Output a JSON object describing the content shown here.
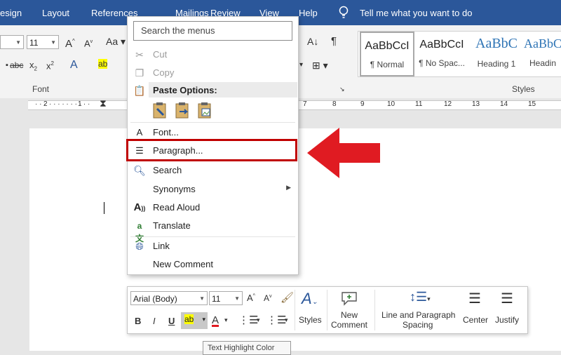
{
  "tabs": [
    "esign",
    "Layout",
    "References",
    "Mailings",
    "Review",
    "View",
    "Help"
  ],
  "tell_me": "Tell me what you want to do",
  "ribbon": {
    "font_size": "11",
    "font_group_label": "Font",
    "styles_group_label": "Styles",
    "styles": [
      {
        "preview": "AaBbCcI",
        "name": "¶ Normal"
      },
      {
        "preview": "AaBbCcI",
        "name": "¶ No Spac..."
      },
      {
        "preview": "AaBbC",
        "name": "Heading 1"
      },
      {
        "preview": "AaBbC",
        "name": "Headin"
      }
    ]
  },
  "ruler": {
    "left_numbers": [
      "1",
      "2",
      "1"
    ],
    "right_numbers": [
      "7",
      "8",
      "9",
      "10",
      "11",
      "12",
      "13",
      "14",
      "15"
    ]
  },
  "context_menu": {
    "search_placeholder": "Search the menus",
    "cut": "Cut",
    "copy": "Copy",
    "paste_options": "Paste Options:",
    "font": "Font...",
    "paragraph": "Paragraph...",
    "search": "Search",
    "synonyms": "Synonyms",
    "read_aloud": "Read Aloud",
    "translate": "Translate",
    "link": "Link",
    "new_comment": "New Comment"
  },
  "mini_toolbar": {
    "font_name": "Arial (Body)",
    "font_size": "11",
    "bold": "B",
    "italic": "I",
    "underline": "U",
    "styles": "Styles",
    "new_comment_1": "New",
    "new_comment_2": "Comment",
    "line_spacing_1": "Line and Paragraph",
    "line_spacing_2": "Spacing",
    "center": "Center",
    "justify": "Justify"
  },
  "tooltip": "Text Highlight Color",
  "colors": {
    "ribbon_blue": "#2b579a",
    "highlight_red": "#c00000",
    "arrow_red": "#e01b22",
    "highlight_yellow": "#ffff00"
  }
}
